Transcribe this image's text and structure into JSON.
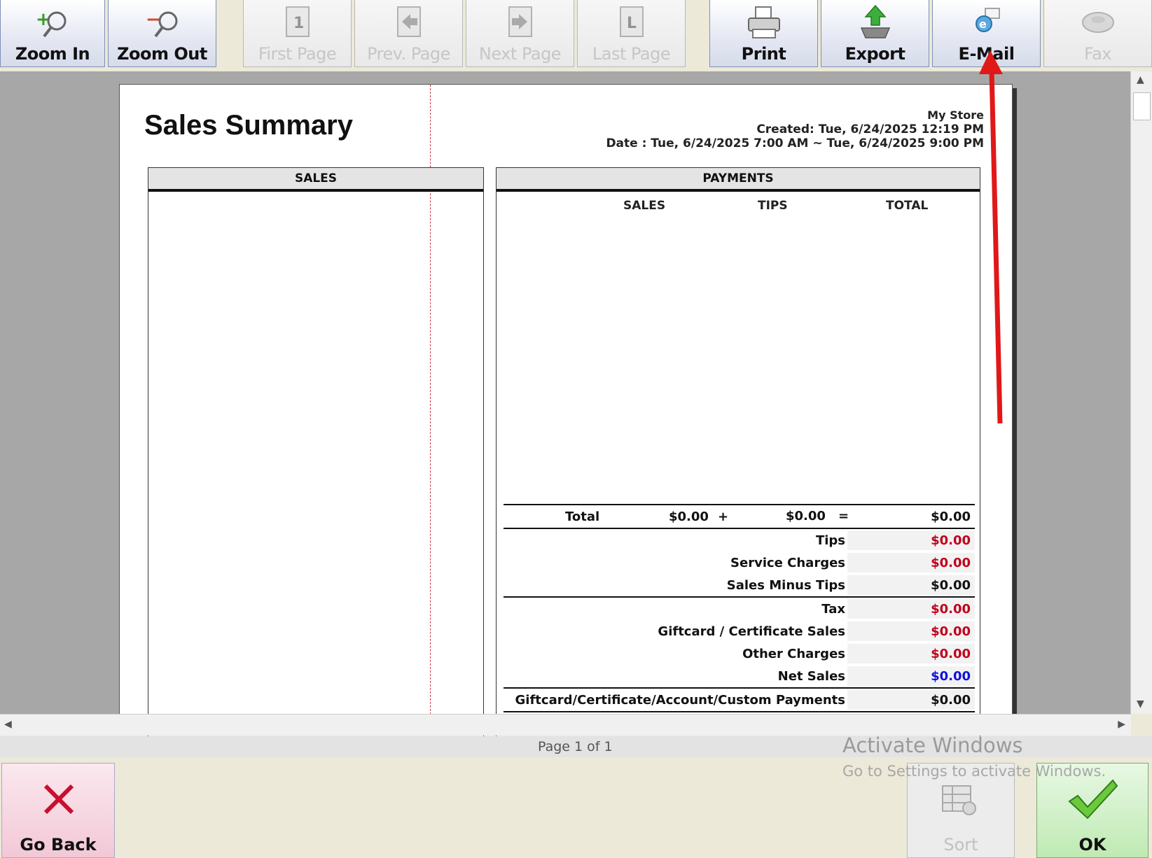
{
  "toolbar": {
    "zoom_in": "Zoom In",
    "zoom_out": "Zoom Out",
    "first_page": "First Page",
    "prev_page": "Prev. Page",
    "next_page": "Next Page",
    "last_page": "Last Page",
    "print": "Print",
    "export": "Export",
    "email": "E-Mail",
    "fax": "Fax"
  },
  "report": {
    "title": "Sales Summary",
    "store": "My Store",
    "created": "Created: Tue, 6/24/2025 12:19 PM",
    "date_range": "Date : Tue, 6/24/2025 7:00 AM ~ Tue, 6/24/2025 9:00 PM",
    "sales_panel_title": "SALES",
    "payments_panel_title": "PAYMENTS",
    "payments_columns": [
      "SALES",
      "TIPS",
      "TOTAL"
    ],
    "total_row": {
      "label": "Total",
      "sales": "$0.00",
      "plus": "+",
      "tips": "$0.00",
      "equals": "=",
      "total": "$0.00"
    },
    "summary_rows": [
      {
        "label": "Tips",
        "value": "$0.00"
      },
      {
        "label": "Service Charges",
        "value": "$0.00"
      },
      {
        "label": "Sales Minus Tips",
        "value": "$0.00"
      },
      {
        "label": "Tax",
        "value": "$0.00"
      },
      {
        "label": "Giftcard / Certificate Sales",
        "value": "$0.00"
      },
      {
        "label": "Other Charges",
        "value": "$0.00"
      },
      {
        "label": "Net Sales",
        "value": "$0.00"
      },
      {
        "label": "Giftcard/Certificate/Account/Custom Payments",
        "value": "$0.00"
      }
    ]
  },
  "status": {
    "page": "Page 1 of 1"
  },
  "watermark": {
    "line1": "Activate Windows",
    "line2": "Go to Settings to activate Windows."
  },
  "footer": {
    "go_back": "Go Back",
    "sort": "Sort",
    "ok": "OK"
  },
  "colors": {
    "red_value": "#c0001a",
    "blue_value": "#1010e0",
    "annotation_arrow": "#e01818"
  }
}
